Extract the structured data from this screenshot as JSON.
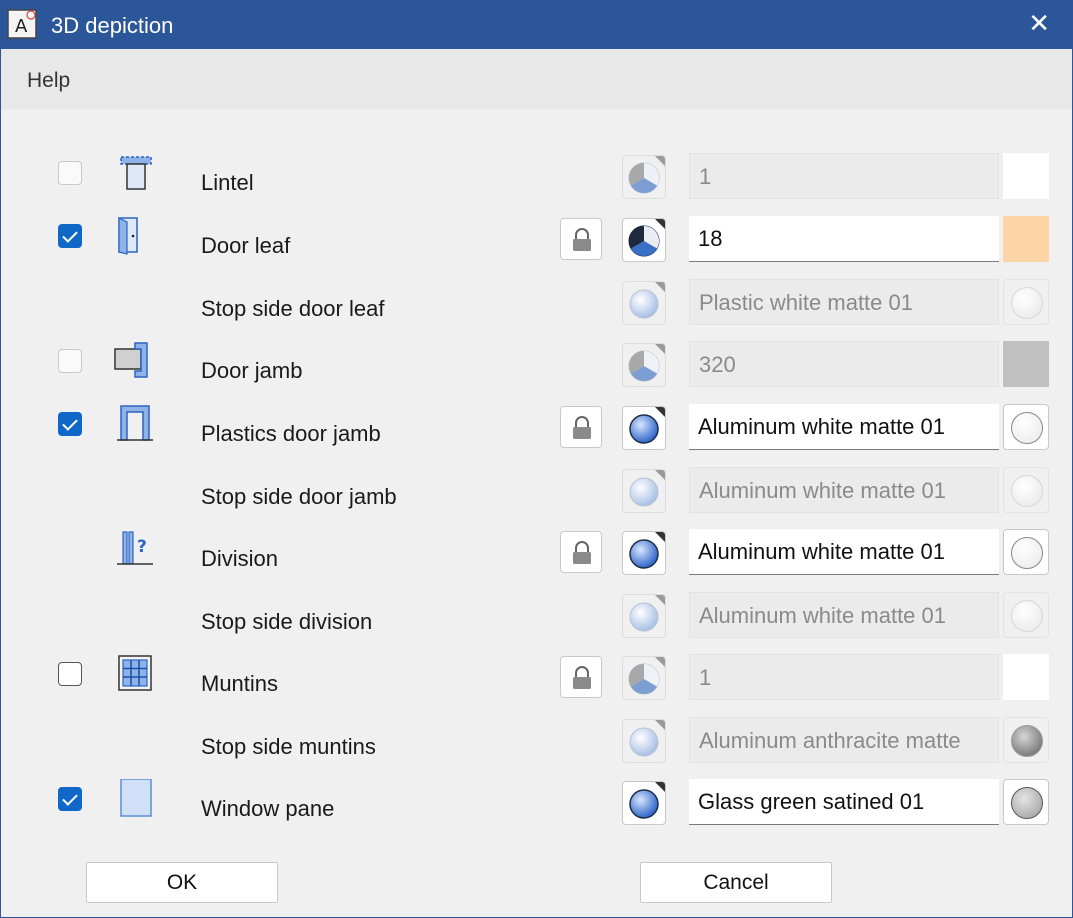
{
  "window": {
    "title": "3D depiction"
  },
  "menu": {
    "help": "Help"
  },
  "rows": [
    {
      "label": "Lintel",
      "value": "1"
    },
    {
      "label": "Door leaf",
      "value": "18"
    },
    {
      "label": "Stop side door leaf",
      "value": "Plastic white matte 01"
    },
    {
      "label": "Door jamb",
      "value": "320"
    },
    {
      "label": "Plastics door jamb",
      "value": "Aluminum white matte 01"
    },
    {
      "label": "Stop side door jamb",
      "value": "Aluminum white matte 01"
    },
    {
      "label": "Division",
      "value": "Aluminum white matte 01"
    },
    {
      "label": "Stop side division",
      "value": "Aluminum white matte 01"
    },
    {
      "label": "Muntins",
      "value": "1"
    },
    {
      "label": "Stop side muntins",
      "value": "Aluminum anthracite matte"
    },
    {
      "label": "Window pane",
      "value": "Glass green satined 01"
    }
  ],
  "colors": {
    "titlebar": "#2b579a",
    "checkbox_checked": "#0f67c8",
    "door_leaf_color": "#fdd4a6",
    "door_jamb_color": "#c0c0c0"
  },
  "buttons": {
    "ok": "OK",
    "cancel": "Cancel"
  }
}
